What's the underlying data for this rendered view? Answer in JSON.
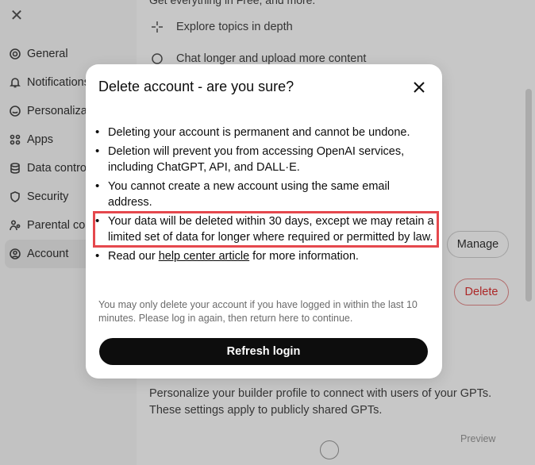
{
  "background": {
    "close_glyph": "✕",
    "nav": [
      {
        "label": "General",
        "icon": "gear-icon"
      },
      {
        "label": "Notifications",
        "icon": "bell-icon"
      },
      {
        "label": "Personalization",
        "icon": "personalization-icon"
      },
      {
        "label": "Apps",
        "icon": "apps-grid-icon"
      },
      {
        "label": "Data controls",
        "icon": "database-icon"
      },
      {
        "label": "Security",
        "icon": "security-icon"
      },
      {
        "label": "Parental controls",
        "icon": "parent-icon"
      },
      {
        "label": "Account",
        "icon": "account-icon"
      }
    ],
    "active_nav": "Account",
    "cut_top_text": "Get everything in Free, and more.",
    "features": [
      {
        "label": "Explore topics in depth",
        "icon": "sparkle-icon"
      },
      {
        "label": "Chat longer and upload more content",
        "icon": "chat-icon"
      }
    ],
    "manage_label": "Manage",
    "delete_label": "Delete",
    "builder_desc": "Personalize your builder profile to connect with users of your GPTs. These settings apply to publicly shared GPTs.",
    "preview_label": "Preview"
  },
  "modal": {
    "title": "Delete account - are you sure?",
    "bullets": [
      "Deleting your account is permanent and cannot be undone.",
      "Deletion will prevent you from accessing OpenAI services, including ChatGPT, API, and DALL·E.",
      "You cannot create a new account using the same email address.",
      "Your data will be deleted within 30 days, except we may retain a limited set of data for longer where required or permitted by law."
    ],
    "read_prefix": "Read our ",
    "read_link": "help center article",
    "read_suffix": " for more information.",
    "note": "You may only delete your account if you have logged in within the last 10 minutes. Please log in again, then return here to continue.",
    "refresh_label": "Refresh login"
  },
  "colors": {
    "highlight": "#e5484d",
    "button_bg": "#0d0d0d",
    "danger": "#d33"
  }
}
